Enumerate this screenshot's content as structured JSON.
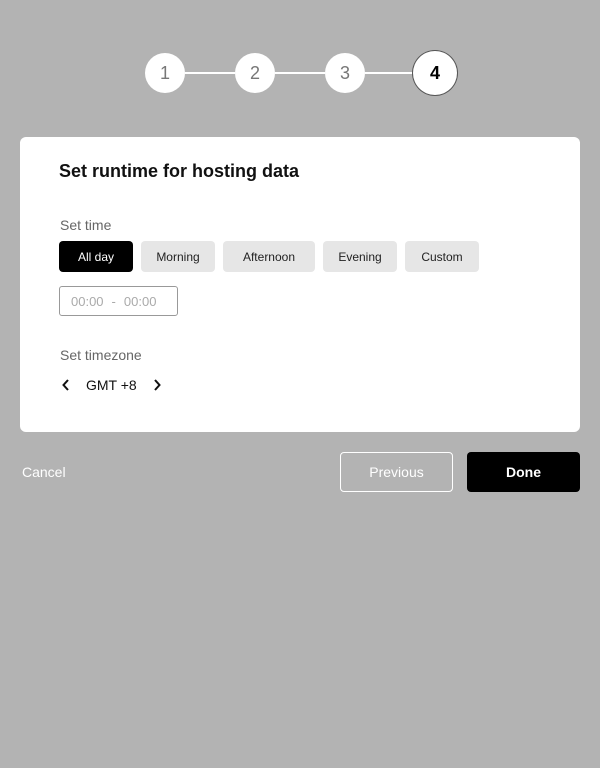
{
  "stepper": {
    "steps": [
      "1",
      "2",
      "3",
      "4"
    ],
    "current": 4
  },
  "card": {
    "title": "Set runtime for hosting data",
    "time_label": "Set time",
    "presets": [
      {
        "label": "All day",
        "selected": true
      },
      {
        "label": "Morning",
        "selected": false
      },
      {
        "label": "Afternoon",
        "selected": false
      },
      {
        "label": "Evening",
        "selected": false
      },
      {
        "label": "Custom",
        "selected": false
      }
    ],
    "time_range": {
      "start": "00:00",
      "separator": "-",
      "end": "00:00"
    },
    "timezone_label": "Set timezone",
    "timezone": {
      "value": "GMT +8",
      "prev_icon": "chevron-left-icon",
      "next_icon": "chevron-right-icon"
    }
  },
  "footer": {
    "cancel_label": "Cancel",
    "previous_label": "Previous",
    "done_label": "Done"
  },
  "colors": {
    "backdrop": "#b3b3b3",
    "card": "#ffffff",
    "primary": "#000000",
    "chip": "#e6e6e6"
  }
}
